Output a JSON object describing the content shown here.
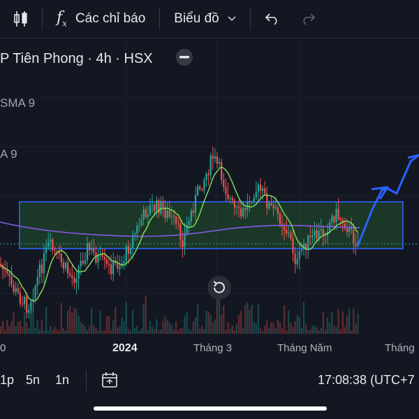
{
  "toolbar": {
    "candles_icon": "candles-icon",
    "indicators_label": "Các chỉ báo",
    "chart_type_label": "Biểu đồ",
    "undo_icon": "undo-icon",
    "redo_icon": "redo-icon"
  },
  "legend": {
    "symbol_line": "P Tiên Phong · 4h · HSX",
    "indicator_1": "SMA 9",
    "indicator_2": "A 9"
  },
  "x_axis": {
    "labels": [
      "0",
      "2024",
      "Tháng 3",
      "Tháng Năm",
      "Tháng"
    ]
  },
  "bottom": {
    "ranges": [
      "1p",
      "5n",
      "1n"
    ],
    "time": "17:08:38 (UTC+7"
  },
  "colors": {
    "background": "#131722",
    "up_candle": "#26a69a",
    "down_candle": "#ef5350",
    "sma_green": "#7ed957",
    "ma_purple": "#7b57d6",
    "zone_fill": "#2e7d32",
    "zone_border": "#2962ff",
    "arrow": "#2962ff"
  },
  "chart_data": {
    "type": "candlestick",
    "description": "",
    "series": [
      {
        "name": "SMA 9",
        "color": "#7ed957"
      },
      {
        "name": "A 9",
        "color": "#7b57d6"
      }
    ]
  }
}
